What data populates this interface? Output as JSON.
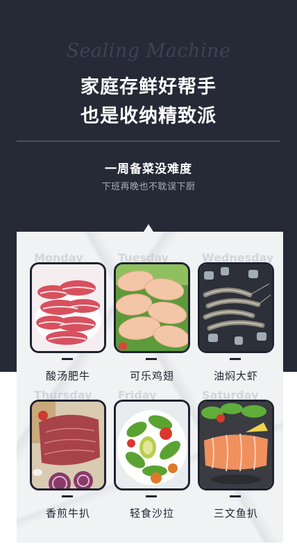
{
  "hero": {
    "script_title": "Sealing Machine",
    "headline_line1": "家庭存鲜好帮手",
    "headline_line2": "也是收纳精致派",
    "subhead": "一周备菜没难度",
    "subline": "下班再晚也不耽误下厨"
  },
  "dishes": [
    {
      "day": "Monday",
      "name": "酸汤肥牛",
      "icon": "sliced-beef-photo"
    },
    {
      "day": "Tuesday",
      "name": "可乐鸡翅",
      "icon": "chicken-wings-photo"
    },
    {
      "day": "Wednesday",
      "name": "油焖大虾",
      "icon": "shrimp-photo"
    },
    {
      "day": "Thursday",
      "name": "香煎牛扒",
      "icon": "steak-photo"
    },
    {
      "day": "Friday",
      "name": "轻食沙拉",
      "icon": "salad-photo"
    },
    {
      "day": "Saturday",
      "name": "三文鱼扒",
      "icon": "salmon-photo"
    }
  ],
  "colors": {
    "background": "#262a36",
    "accent": "#1e2230",
    "panel": "#f1f2f4"
  }
}
